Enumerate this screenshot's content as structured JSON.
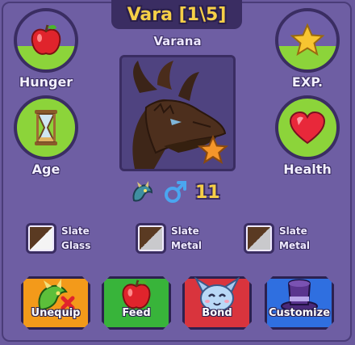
{
  "header": {
    "title": "Vara [1\\5]",
    "subtitle": "Varana"
  },
  "stats": {
    "hunger": {
      "label": "Hunger",
      "icon": "apple-icon",
      "level": 0.4
    },
    "exp": {
      "label": "EXP.",
      "icon": "star-icon",
      "level": 0.4
    },
    "age": {
      "label": "Age",
      "icon": "hourglass-icon",
      "level": 1.0
    },
    "health": {
      "label": "Health",
      "icon": "heart-icon",
      "level": 1.0
    }
  },
  "pet": {
    "portrait": "dragon-portrait",
    "badge": "star-icon",
    "species_icon": "dragon-species-icon",
    "gender_icon": "male-icon",
    "age_value": "11"
  },
  "swatches": [
    {
      "line1": "Slate",
      "line2": "Glass",
      "color_a": "#5a3a22",
      "color_b": "#f4f4f4"
    },
    {
      "line1": "Slate",
      "line2": "Metal",
      "color_a": "#5a3a22",
      "color_b": "#c9c9cc"
    },
    {
      "line1": "Slate",
      "line2": "Metal",
      "color_a": "#5a3a22",
      "color_b": "#c9c9cc"
    }
  ],
  "actions": [
    {
      "label": "Unequip",
      "color": "#f39a1a",
      "icon": "dragon-remove-icon"
    },
    {
      "label": "Feed",
      "color": "#38b43a",
      "icon": "apple-icon"
    },
    {
      "label": "Bond",
      "color": "#d9343d",
      "icon": "creature-face-icon"
    },
    {
      "label": "Customize",
      "color": "#2f6fe0",
      "icon": "top-hat-icon"
    }
  ],
  "colors": {
    "gold": "#f6cf47",
    "bar_green": "#8cd43a",
    "panel": "#6e5ea3",
    "outline": "#3a2d62"
  }
}
